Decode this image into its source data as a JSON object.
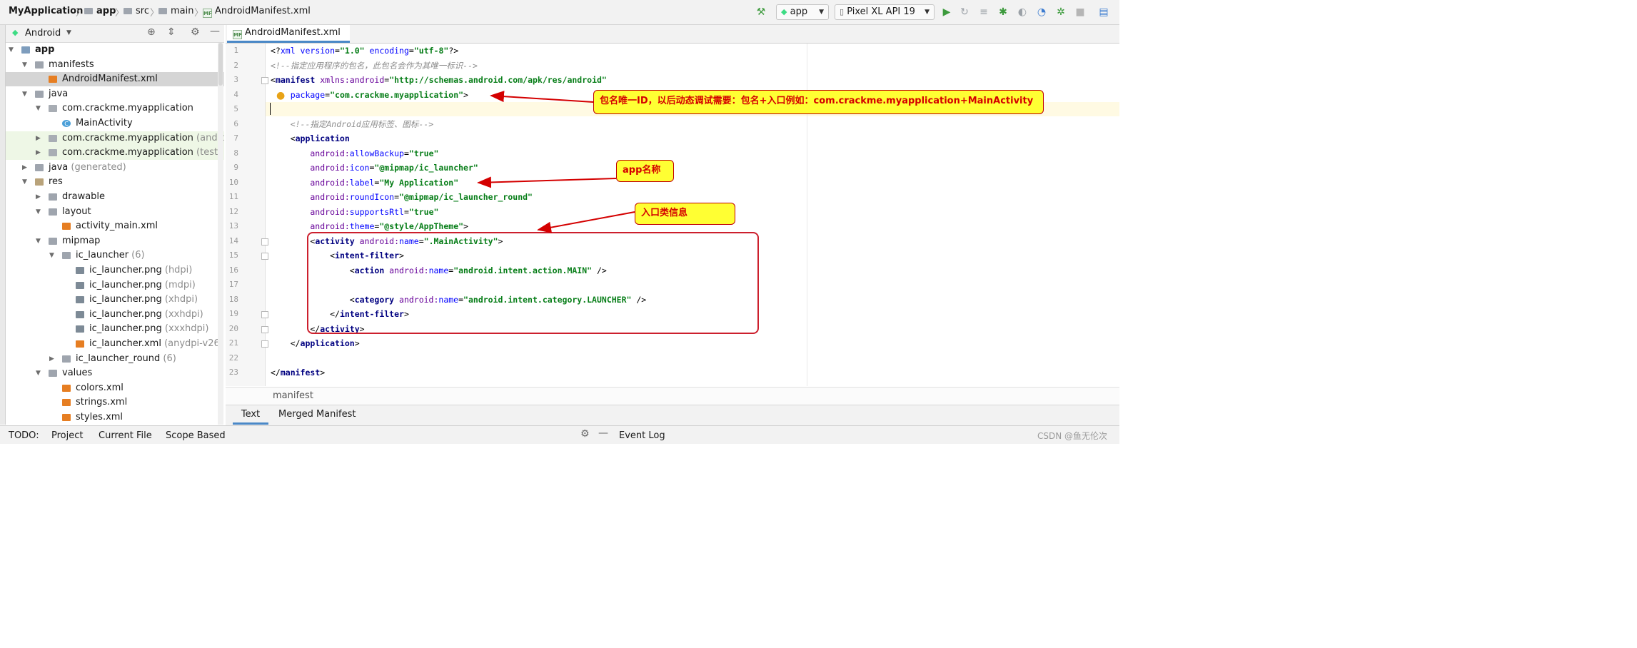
{
  "breadcrumb": {
    "project": "MyApplication",
    "items": [
      "app",
      "src",
      "main",
      "AndroidManifest.xml"
    ]
  },
  "toolbar": {
    "run_config": "app",
    "device": "Pixel XL API 19"
  },
  "project_panel": {
    "view_mode": "Android",
    "tree": [
      {
        "label": "app",
        "suffix": "",
        "bold": true,
        "icon": "module-icon",
        "arrow": "open"
      },
      {
        "label": "manifests",
        "suffix": "",
        "icon": "folder-icon",
        "arrow": "open"
      },
      {
        "label": "AndroidManifest.xml",
        "suffix": "",
        "icon": "manifest-file-icon",
        "arrow": "none",
        "selected": true
      },
      {
        "label": "java",
        "suffix": "",
        "icon": "folder-icon",
        "arrow": "open"
      },
      {
        "label": "com.crackme.myapplication",
        "suffix": "",
        "icon": "package-icon",
        "arrow": "open"
      },
      {
        "label": "MainActivity",
        "suffix": "",
        "icon": "class-icon",
        "arrow": "none"
      },
      {
        "label": "com.crackme.myapplication",
        "suffix": " (androidTe",
        "icon": "package-icon",
        "arrow": "closed",
        "tint": true
      },
      {
        "label": "com.crackme.myapplication",
        "suffix": " (test)",
        "icon": "package-icon",
        "arrow": "closed",
        "tint": true
      },
      {
        "label": "java",
        "suffix": " (generated)",
        "icon": "folder-icon",
        "arrow": "closed"
      },
      {
        "label": "res",
        "suffix": "",
        "icon": "res-folder-icon",
        "arrow": "open"
      },
      {
        "label": "drawable",
        "suffix": "",
        "icon": "folder-icon",
        "arrow": "closed"
      },
      {
        "label": "layout",
        "suffix": "",
        "icon": "folder-icon",
        "arrow": "open"
      },
      {
        "label": "activity_main.xml",
        "suffix": "",
        "icon": "xml-file-icon",
        "arrow": "none"
      },
      {
        "label": "mipmap",
        "suffix": "",
        "icon": "folder-icon",
        "arrow": "open"
      },
      {
        "label": "ic_launcher",
        "suffix": " (6)",
        "icon": "folder-icon",
        "arrow": "open"
      },
      {
        "label": "ic_launcher.png",
        "suffix": " (hdpi)",
        "icon": "png-file-icon",
        "arrow": "none"
      },
      {
        "label": "ic_launcher.png",
        "suffix": " (mdpi)",
        "icon": "png-file-icon",
        "arrow": "none"
      },
      {
        "label": "ic_launcher.png",
        "suffix": " (xhdpi)",
        "icon": "png-file-icon",
        "arrow": "none"
      },
      {
        "label": "ic_launcher.png",
        "suffix": " (xxhdpi)",
        "icon": "png-file-icon",
        "arrow": "none"
      },
      {
        "label": "ic_launcher.png",
        "suffix": " (xxxhdpi)",
        "icon": "png-file-icon",
        "arrow": "none"
      },
      {
        "label": "ic_launcher.xml",
        "suffix": " (anydpi-v26)",
        "icon": "xml-file-icon",
        "arrow": "none"
      },
      {
        "label": "ic_launcher_round",
        "suffix": " (6)",
        "icon": "folder-icon",
        "arrow": "closed"
      },
      {
        "label": "values",
        "suffix": "",
        "icon": "folder-icon",
        "arrow": "open"
      },
      {
        "label": "colors.xml",
        "suffix": "",
        "icon": "xml-file-icon",
        "arrow": "none"
      },
      {
        "label": "strings.xml",
        "suffix": "",
        "icon": "xml-file-icon",
        "arrow": "none"
      },
      {
        "label": "styles.xml",
        "suffix": "",
        "icon": "xml-file-icon",
        "arrow": "none"
      }
    ]
  },
  "editor": {
    "tab_label": "AndroidManifest.xml",
    "line_numbers": [
      "1",
      "2",
      "3",
      "4",
      "5",
      "6",
      "7",
      "8",
      "9",
      "10",
      "11",
      "12",
      "13",
      "14",
      "15",
      "16",
      "17",
      "18",
      "19",
      "20",
      "21",
      "22",
      "23"
    ],
    "lines": [
      [
        {
          "t": "<?",
          "c": "br"
        },
        {
          "t": "xml version",
          "c": "aname"
        },
        {
          "t": "=",
          "c": "br"
        },
        {
          "t": "\"1.0\"",
          "c": "str"
        },
        {
          "t": " encoding",
          "c": "aname"
        },
        {
          "t": "=",
          "c": "br"
        },
        {
          "t": "\"utf-8\"",
          "c": "str"
        },
        {
          "t": "?>",
          "c": "br"
        }
      ],
      [
        {
          "t": "<!--指定应用程序的包名，此包名会作为其唯一标识-->",
          "c": "cm"
        }
      ],
      [
        {
          "t": "<",
          "c": "br"
        },
        {
          "t": "manifest",
          "c": "tag"
        },
        {
          "t": " xmlns:",
          "c": "ns"
        },
        {
          "t": "android",
          "c": "attr"
        },
        {
          "t": "=",
          "c": "br"
        },
        {
          "t": "\"http://schemas.android.com/apk/res/android\"",
          "c": "str"
        }
      ],
      [
        {
          "t": "    package",
          "c": "aname"
        },
        {
          "t": "=",
          "c": "br"
        },
        {
          "t": "\"com.crackme.myapplication\"",
          "c": "str"
        },
        {
          "t": ">",
          "c": "br"
        }
      ],
      [],
      [
        {
          "t": "    <!--指定Android应用标签、图标-->",
          "c": "cm"
        }
      ],
      [
        {
          "t": "    <",
          "c": "br"
        },
        {
          "t": "application",
          "c": "tag"
        }
      ],
      [
        {
          "t": "        android:",
          "c": "ns"
        },
        {
          "t": "allowBackup",
          "c": "aname"
        },
        {
          "t": "=",
          "c": "br"
        },
        {
          "t": "\"true\"",
          "c": "str"
        }
      ],
      [
        {
          "t": "        android:",
          "c": "ns"
        },
        {
          "t": "icon",
          "c": "aname"
        },
        {
          "t": "=",
          "c": "br"
        },
        {
          "t": "\"@mipmap/ic_launcher\"",
          "c": "str"
        }
      ],
      [
        {
          "t": "        android:",
          "c": "ns"
        },
        {
          "t": "label",
          "c": "aname"
        },
        {
          "t": "=",
          "c": "br"
        },
        {
          "t": "\"My Application\"",
          "c": "str"
        }
      ],
      [
        {
          "t": "        android:",
          "c": "ns"
        },
        {
          "t": "roundIcon",
          "c": "aname"
        },
        {
          "t": "=",
          "c": "br"
        },
        {
          "t": "\"@mipmap/ic_launcher_round\"",
          "c": "str"
        }
      ],
      [
        {
          "t": "        android:",
          "c": "ns"
        },
        {
          "t": "supportsRtl",
          "c": "aname"
        },
        {
          "t": "=",
          "c": "br"
        },
        {
          "t": "\"true\"",
          "c": "str"
        }
      ],
      [
        {
          "t": "        android:",
          "c": "ns"
        },
        {
          "t": "theme",
          "c": "aname"
        },
        {
          "t": "=",
          "c": "br"
        },
        {
          "t": "\"@style/AppTheme\"",
          "c": "str"
        },
        {
          "t": ">",
          "c": "br"
        }
      ],
      [
        {
          "t": "        <",
          "c": "br"
        },
        {
          "t": "activity",
          "c": "tag"
        },
        {
          "t": " android:",
          "c": "ns"
        },
        {
          "t": "name",
          "c": "aname"
        },
        {
          "t": "=",
          "c": "br"
        },
        {
          "t": "\".MainActivity\"",
          "c": "str"
        },
        {
          "t": ">",
          "c": "br"
        }
      ],
      [
        {
          "t": "            <",
          "c": "br"
        },
        {
          "t": "intent-filter",
          "c": "tag"
        },
        {
          "t": ">",
          "c": "br"
        }
      ],
      [
        {
          "t": "                <",
          "c": "br"
        },
        {
          "t": "action",
          "c": "tag"
        },
        {
          "t": " android:",
          "c": "ns"
        },
        {
          "t": "name",
          "c": "aname"
        },
        {
          "t": "=",
          "c": "br"
        },
        {
          "t": "\"android.intent.action.MAIN\"",
          "c": "str"
        },
        {
          "t": " />",
          "c": "br"
        }
      ],
      [],
      [
        {
          "t": "                <",
          "c": "br"
        },
        {
          "t": "category",
          "c": "tag"
        },
        {
          "t": " android:",
          "c": "ns"
        },
        {
          "t": "name",
          "c": "aname"
        },
        {
          "t": "=",
          "c": "br"
        },
        {
          "t": "\"android.intent.category.LAUNCHER\"",
          "c": "str"
        },
        {
          "t": " />",
          "c": "br"
        }
      ],
      [
        {
          "t": "            </",
          "c": "br"
        },
        {
          "t": "intent-filter",
          "c": "tag"
        },
        {
          "t": ">",
          "c": "br"
        }
      ],
      [
        {
          "t": "        </",
          "c": "br"
        },
        {
          "t": "activity",
          "c": "tag"
        },
        {
          "t": ">",
          "c": "br"
        }
      ],
      [
        {
          "t": "    </",
          "c": "br"
        },
        {
          "t": "application",
          "c": "tag"
        },
        {
          "t": ">",
          "c": "br"
        }
      ],
      [],
      [
        {
          "t": "</",
          "c": "br"
        },
        {
          "t": "manifest",
          "c": "tag"
        },
        {
          "t": ">",
          "c": "br"
        }
      ]
    ],
    "breadcrumb": "manifest",
    "bottom_tabs": [
      "Text",
      "Merged Manifest"
    ]
  },
  "annotations": {
    "package_note": "包名唯一ID，以后动态调试需要：包名+入口例如：com.crackme.myapplication+MainActivity",
    "app_name_note": "app名称",
    "entry_note": "入口类信息",
    "color": "#d40000",
    "fill": "#ffff33"
  },
  "status_bar": {
    "items": [
      "TODO:",
      "Project",
      "Current File",
      "Scope Based"
    ],
    "event_log": "Event Log",
    "watermark": "CSDN @鱼无伦次"
  }
}
